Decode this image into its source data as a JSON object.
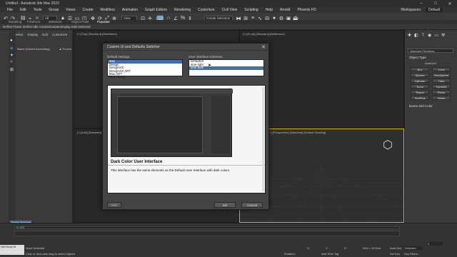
{
  "window": {
    "title": "Untitled - Autodesk 3ds Max 2023",
    "minimize": "–",
    "maximize": "□",
    "close": "✕"
  },
  "menu": [
    "File",
    "Edit",
    "Tools",
    "Group",
    "Views",
    "Create",
    "Modifiers",
    "Animation",
    "Graph Editors",
    "Rendering",
    "Customize",
    "Civil View",
    "Scripting",
    "Help",
    "Arnold",
    "Phoenix FD"
  ],
  "workspace": {
    "label": "Workspaces:",
    "value": "Default"
  },
  "toolbar": {
    "all_filter": "All",
    "view_dropdown": "View",
    "selection_set": "Create Selection Se"
  },
  "ribbon_tabs": [
    "Modeling",
    "Freeform",
    "Selection",
    "Object Paint",
    "Populate"
  ],
  "ribbon_row2": [
    "Define Flows",
    "Define Idle Areas",
    "Simulate",
    "Display",
    "Edit Selected"
  ],
  "scene_explorer": {
    "tabs": [
      "Select",
      "Display",
      "Edit",
      "Customize"
    ],
    "name_header": "Name (Sorted Ascending)",
    "frozen_header": "▲ Frozen",
    "label": "Scene Explorer"
  },
  "viewports": {
    "top": "[+] [Top] [Standard] [Wireframe]",
    "front": "[+] [Front] [Standard] [Wireframe]",
    "left": "[+] [Left] [Standard] [Wireframe]",
    "persp": "[+] [Perspective] [Standard] [Default Shading]"
  },
  "command_panel": {
    "dropdown": "Standard Primitives",
    "object_type": "Object Type",
    "autogrid": "AutoGrid",
    "buttons": [
      "Box",
      "Cone",
      "Sphere",
      "GeoSphere",
      "Cylinder",
      "Tube",
      "Torus",
      "Pyramid",
      "Teapot",
      "Plane",
      "TextPlus",
      "Teflon"
    ],
    "name_color": "Name and Color"
  },
  "dialog": {
    "title": "Custom UI and Defaults Switcher",
    "close": "✕",
    "defaults_label": "Default settings:",
    "defaults_items": [
      "Max",
      "Design",
      "DesignVIZ",
      "DesignVIZ.ART",
      "Max.ART",
      "Max.Legacy"
    ],
    "defaults_selected": 0,
    "schemes_label": "User interface schemes:",
    "schemes_items": [
      "DefaultUI",
      "ame-light",
      "ame-dark"
    ],
    "schemes_selected": 2,
    "preview_heading": "Dark Color User Interface",
    "preview_text": "This interface has the same elements as the Default User Interface with dark colors.",
    "btn_left": "<<<",
    "btn_set": "Set",
    "btn_cancel": "Cancel"
  },
  "status": {
    "frame": "0 / 100",
    "none_selected": "None Selected",
    "hint": "Click or click-and-drag to select objects",
    "x": "X:",
    "y": "Y:",
    "z": "Z:",
    "grid": "Grid = 10.0cm",
    "add_time_tag": "Add Time Tag",
    "enabled": "Enabled:",
    "auto_key": "Auto Key",
    "selected": "Selected",
    "set_key": "Set Key",
    "key_filters": "Key Filters...",
    "maxscript": "MAXScript Mi",
    "frame_value": "0"
  },
  "colors": {
    "accent": "#3f6fb2",
    "panel": "#3a3a3a",
    "viewport": "#282828",
    "active_border": "#e0b000"
  }
}
